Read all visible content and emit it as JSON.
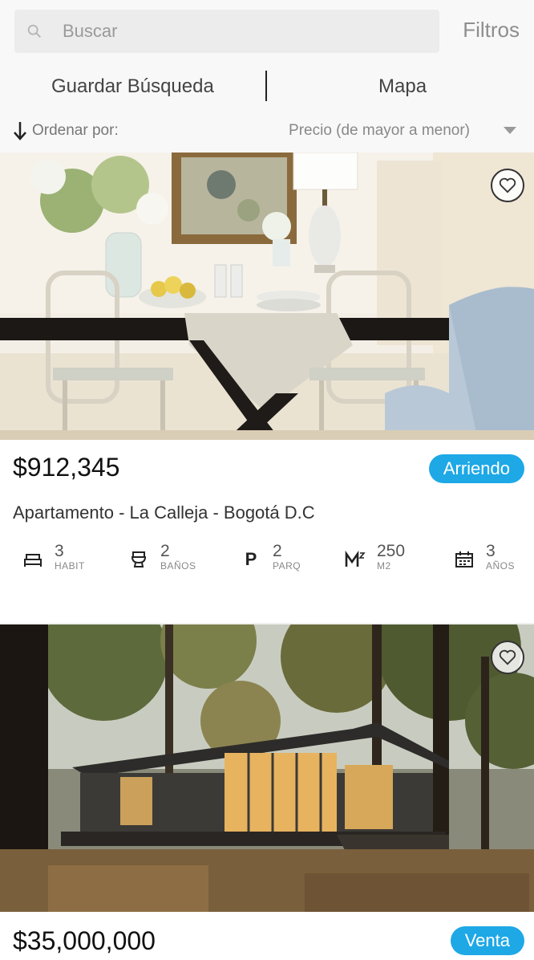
{
  "search": {
    "placeholder": "Buscar",
    "filters_label": "Filtros"
  },
  "actions": {
    "save_search": "Guardar Búsqueda",
    "map": "Mapa"
  },
  "sort": {
    "label": "Ordenar por:",
    "value": "Precio (de mayor a menor)"
  },
  "colors": {
    "accent": "#1ea8e6"
  },
  "listings": [
    {
      "price": "$912,345",
      "badge": "Arriendo",
      "address": "Apartamento - La Calleja - Bogotá D.C",
      "stats": [
        {
          "icon": "bed-icon",
          "value": "3",
          "unit": "HABIT"
        },
        {
          "icon": "toilet-icon",
          "value": "2",
          "unit": "BAÑOS"
        },
        {
          "icon": "parking-icon",
          "value": "2",
          "unit": "PARQ"
        },
        {
          "icon": "area-icon",
          "value": "250",
          "unit": "M2"
        },
        {
          "icon": "calendar-icon",
          "value": "3",
          "unit": "AÑOS"
        }
      ]
    },
    {
      "price": "$35,000,000",
      "badge": "Venta",
      "address": "",
      "stats": []
    }
  ]
}
